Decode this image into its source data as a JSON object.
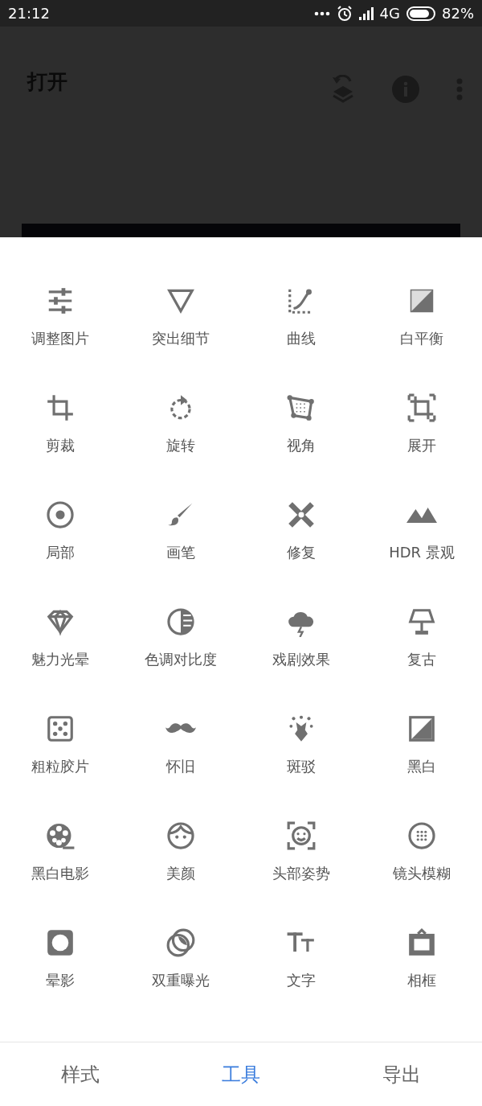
{
  "status_bar": {
    "time": "21:12",
    "network": "4G",
    "battery": "82%"
  },
  "app_bar": {
    "title": "打开"
  },
  "tools": [
    {
      "label": "调整图片",
      "kind": "sliders"
    },
    {
      "label": "突出细节",
      "kind": "triangle"
    },
    {
      "label": "曲线",
      "kind": "curve"
    },
    {
      "label": "白平衡",
      "kind": "balance"
    },
    {
      "label": "剪裁",
      "kind": "crop"
    },
    {
      "label": "旋转",
      "kind": "rotate"
    },
    {
      "label": "视角",
      "kind": "perspective"
    },
    {
      "label": "展开",
      "kind": "expand"
    },
    {
      "label": "局部",
      "kind": "target"
    },
    {
      "label": "画笔",
      "kind": "brush"
    },
    {
      "label": "修复",
      "kind": "bandage"
    },
    {
      "label": "HDR 景观",
      "kind": "mountains"
    },
    {
      "label": "魅力光晕",
      "kind": "diamond"
    },
    {
      "label": "色调对比度",
      "kind": "halfcircle"
    },
    {
      "label": "戏剧效果",
      "kind": "cloud"
    },
    {
      "label": "复古",
      "kind": "lamp"
    },
    {
      "label": "粗粒胶片",
      "kind": "dice"
    },
    {
      "label": "怀旧",
      "kind": "mustache"
    },
    {
      "label": "斑驳",
      "kind": "splatter"
    },
    {
      "label": "黑白",
      "kind": "bw"
    },
    {
      "label": "黑白电影",
      "kind": "reel"
    },
    {
      "label": "美颜",
      "kind": "face"
    },
    {
      "label": "头部姿势",
      "kind": "faceframe"
    },
    {
      "label": "镜头模糊",
      "kind": "dots"
    },
    {
      "label": "晕影",
      "kind": "vignette"
    },
    {
      "label": "双重曝光",
      "kind": "circles"
    },
    {
      "label": "文字",
      "kind": "text"
    },
    {
      "label": "相框",
      "kind": "frame"
    }
  ],
  "bottom_tabs": [
    {
      "label": "样式",
      "selected": false
    },
    {
      "label": "工具",
      "selected": true
    },
    {
      "label": "导出",
      "selected": false
    }
  ]
}
